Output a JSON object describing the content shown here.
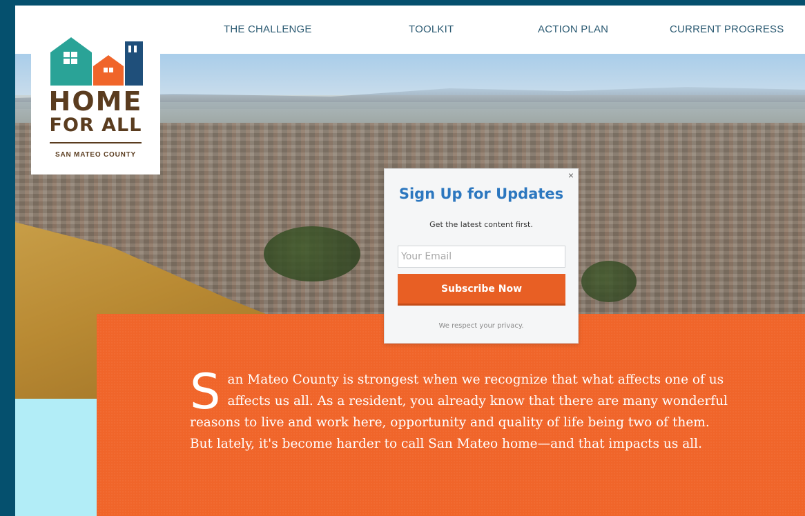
{
  "nav": {
    "items": [
      {
        "label": "THE CHALLENGE"
      },
      {
        "label": "TOOLKIT"
      },
      {
        "label": "ACTION PLAN"
      },
      {
        "label": "CURRENT PROGRESS"
      }
    ]
  },
  "logo": {
    "line1": "HOME",
    "line2": "FOR ALL",
    "line3": "SAN MATEO COUNTY",
    "colors": {
      "teal": "#2aa397",
      "orange": "#f0652a",
      "navy": "#1f4f7a",
      "brown": "#5a3c1f"
    }
  },
  "popup": {
    "close": "×",
    "title": "Sign Up for Updates",
    "subtitle": "Get the latest content first.",
    "email_placeholder": "Your Email",
    "button_label": "Subscribe Now",
    "privacy": "We respect your privacy."
  },
  "content": {
    "drop_cap": "S",
    "paragraph1": "an Mateo County is strongest when we recognize that what affects one of us affects us all. As a resident, you already know that there are many wonderful reasons to live and work here, opportunity and quality of life being two of them.",
    "paragraph2": "But lately, it's become harder to call San Mateo home—and that impacts us all."
  },
  "colors": {
    "frame_background": "#05506e",
    "accent_orange": "#f0652a",
    "light_blue": "#b2edf7",
    "nav_text": "#2b5a72",
    "popup_title": "#2c77bf"
  }
}
